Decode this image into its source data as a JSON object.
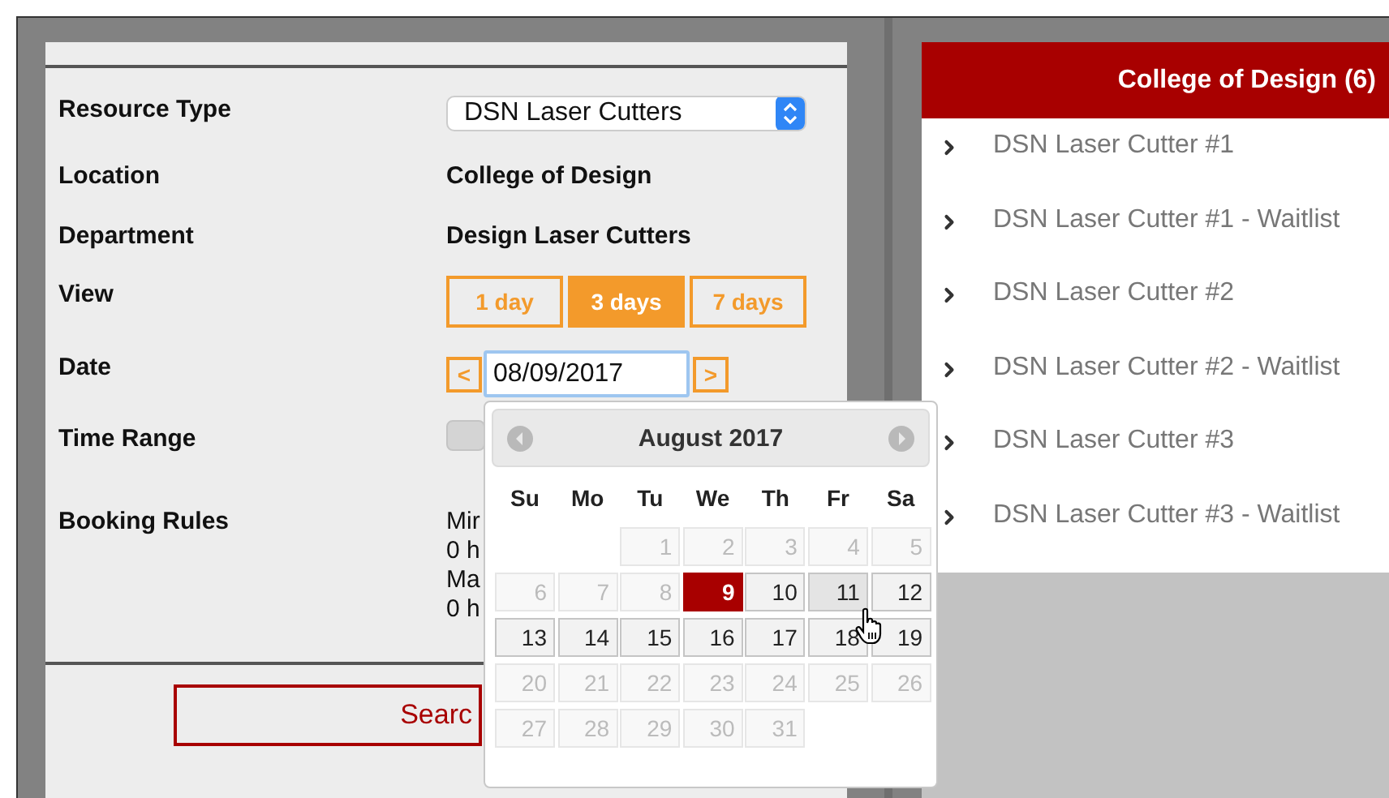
{
  "resource_type": {
    "label": "Resource Type",
    "value": "DSN Laser Cutters"
  },
  "location": {
    "label": "Location",
    "value": "College of Design"
  },
  "department": {
    "label": "Department",
    "value": "Design Laser Cutters"
  },
  "view": {
    "label": "View",
    "options": [
      {
        "label": "1 day",
        "selected": false
      },
      {
        "label": "3 days",
        "selected": true
      },
      {
        "label": "7 days",
        "selected": false
      }
    ]
  },
  "date": {
    "label": "Date",
    "prev": "<",
    "value": "08/09/2017",
    "next": ">"
  },
  "time_range": {
    "label": "Time Range"
  },
  "booking_rules": {
    "label": "Booking Rules",
    "lines": [
      "Mir",
      "0 h",
      "Ma",
      "0 h"
    ]
  },
  "search_button": "Searc",
  "calendar": {
    "title": "August 2017",
    "weekdays": [
      "Su",
      "Mo",
      "Tu",
      "We",
      "Th",
      "Fr",
      "Sa"
    ],
    "weeks": [
      [
        {
          "kind": "blank"
        },
        {
          "kind": "blank"
        },
        {
          "kind": "day",
          "label": "1",
          "disabled": true,
          "selected": false,
          "hovered": false
        },
        {
          "kind": "day",
          "label": "2",
          "disabled": true,
          "selected": false,
          "hovered": false
        },
        {
          "kind": "day",
          "label": "3",
          "disabled": true,
          "selected": false,
          "hovered": false
        },
        {
          "kind": "day",
          "label": "4",
          "disabled": true,
          "selected": false,
          "hovered": false
        },
        {
          "kind": "day",
          "label": "5",
          "disabled": true,
          "selected": false,
          "hovered": false
        }
      ],
      [
        {
          "kind": "day",
          "label": "6",
          "disabled": true,
          "selected": false,
          "hovered": false
        },
        {
          "kind": "day",
          "label": "7",
          "disabled": true,
          "selected": false,
          "hovered": false
        },
        {
          "kind": "day",
          "label": "8",
          "disabled": true,
          "selected": false,
          "hovered": false
        },
        {
          "kind": "day",
          "label": "9",
          "disabled": false,
          "selected": true,
          "hovered": false
        },
        {
          "kind": "day",
          "label": "10",
          "disabled": false,
          "selected": false,
          "hovered": false
        },
        {
          "kind": "day",
          "label": "11",
          "disabled": false,
          "selected": false,
          "hovered": true
        },
        {
          "kind": "day",
          "label": "12",
          "disabled": false,
          "selected": false,
          "hovered": false
        }
      ],
      [
        {
          "kind": "day",
          "label": "13",
          "disabled": false,
          "selected": false,
          "hovered": false
        },
        {
          "kind": "day",
          "label": "14",
          "disabled": false,
          "selected": false,
          "hovered": false
        },
        {
          "kind": "day",
          "label": "15",
          "disabled": false,
          "selected": false,
          "hovered": false
        },
        {
          "kind": "day",
          "label": "16",
          "disabled": false,
          "selected": false,
          "hovered": false
        },
        {
          "kind": "day",
          "label": "17",
          "disabled": false,
          "selected": false,
          "hovered": false
        },
        {
          "kind": "day",
          "label": "18",
          "disabled": false,
          "selected": false,
          "hovered": false
        },
        {
          "kind": "day",
          "label": "19",
          "disabled": false,
          "selected": false,
          "hovered": false
        }
      ],
      [
        {
          "kind": "day",
          "label": "20",
          "disabled": true,
          "selected": false,
          "hovered": false
        },
        {
          "kind": "day",
          "label": "21",
          "disabled": true,
          "selected": false,
          "hovered": false
        },
        {
          "kind": "day",
          "label": "22",
          "disabled": true,
          "selected": false,
          "hovered": false
        },
        {
          "kind": "day",
          "label": "23",
          "disabled": true,
          "selected": false,
          "hovered": false
        },
        {
          "kind": "day",
          "label": "24",
          "disabled": true,
          "selected": false,
          "hovered": false
        },
        {
          "kind": "day",
          "label": "25",
          "disabled": true,
          "selected": false,
          "hovered": false
        },
        {
          "kind": "day",
          "label": "26",
          "disabled": true,
          "selected": false,
          "hovered": false
        }
      ],
      [
        {
          "kind": "day",
          "label": "27",
          "disabled": true,
          "selected": false,
          "hovered": false
        },
        {
          "kind": "day",
          "label": "28",
          "disabled": true,
          "selected": false,
          "hovered": false
        },
        {
          "kind": "day",
          "label": "29",
          "disabled": true,
          "selected": false,
          "hovered": false
        },
        {
          "kind": "day",
          "label": "30",
          "disabled": true,
          "selected": false,
          "hovered": false
        },
        {
          "kind": "day",
          "label": "31",
          "disabled": true,
          "selected": false,
          "hovered": false
        }
      ]
    ]
  },
  "results": {
    "header": "College of Design (6)",
    "items": [
      "DSN Laser Cutter #1",
      "DSN Laser Cutter #1 - Waitlist",
      "DSN Laser Cutter #2",
      "DSN Laser Cutter #2 - Waitlist",
      "DSN Laser Cutter #3",
      "DSN Laser Cutter #3 - Waitlist"
    ]
  }
}
